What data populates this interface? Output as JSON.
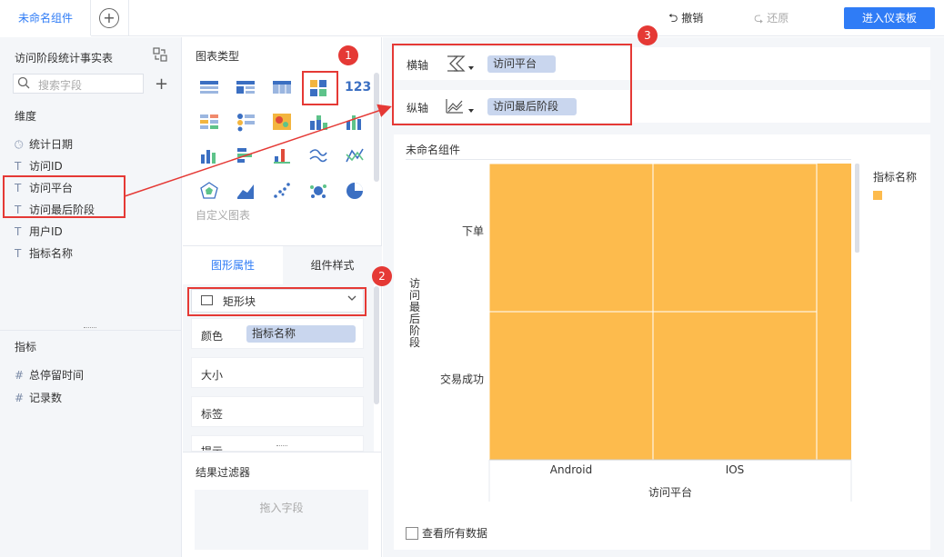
{
  "topbar": {
    "tab_title": "未命名组件",
    "add_tab": "+",
    "undo_label": "撤销",
    "redo_label": "还原",
    "enter_dashboard": "进入仪表板"
  },
  "left": {
    "table_name": "访问阶段统计事实表",
    "search_placeholder": "搜索字段",
    "dimension_header": "维度",
    "dimensions": [
      {
        "icon": "clock-icon",
        "label": "统计日期"
      },
      {
        "icon": "text-icon",
        "label": "访问ID"
      },
      {
        "icon": "text-icon",
        "label": "访问平台"
      },
      {
        "icon": "text-icon",
        "label": "访问最后阶段"
      },
      {
        "icon": "text-icon",
        "label": "用户ID"
      },
      {
        "icon": "text-icon",
        "label": "指标名称"
      }
    ],
    "measure_header": "指标",
    "measures": [
      {
        "icon": "hash-icon",
        "label": "总停留时间"
      },
      {
        "icon": "hash-icon",
        "label": "记录数"
      }
    ]
  },
  "middle": {
    "chart_type_header": "图表类型",
    "custom_chart": "自定义图表",
    "tab_graphic": "图形属性",
    "tab_style": "组件样式",
    "shape_select": "矩形块",
    "color_label": "颜色",
    "color_field": "指标名称",
    "size_label": "大小",
    "label_label": "标签",
    "tooltip_label": "提示",
    "filter_header": "结果过滤器",
    "filter_drop": "拖入字段"
  },
  "right": {
    "x_axis_label": "横轴",
    "x_axis_field": "访问平台",
    "y_axis_label": "纵轴",
    "y_axis_field": "访问最后阶段",
    "chart_title": "未命名组件",
    "legend_title": "指标名称",
    "view_all": "查看所有数据"
  },
  "chart_data": {
    "type": "heatmap",
    "title": "未命名组件",
    "xlabel": "访问平台",
    "ylabel": "访问最后阶段",
    "x_categories": [
      "Android",
      "IOS"
    ],
    "y_categories": [
      "下单",
      "交易成功"
    ],
    "cell_color": "#fdbb4d"
  },
  "annotations": {
    "badge1": "1",
    "badge2": "2",
    "badge3": "3"
  },
  "colors": {
    "accent": "#2f7cf6",
    "cell": "#fdbb4d",
    "pill": "#c9d6ee",
    "annotation": "#e53935"
  }
}
